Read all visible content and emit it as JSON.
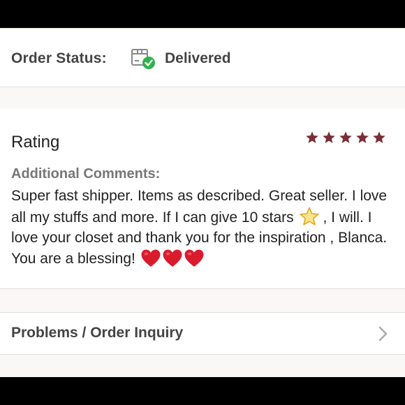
{
  "order_status": {
    "label": "Order Status:",
    "value": "Delivered",
    "icon": "package-delivered-icon"
  },
  "rating": {
    "title": "Rating",
    "stars": 5,
    "max_stars": 5,
    "star_color": "#7b2d35",
    "comments_label": "Additional Comments:",
    "comment_parts": [
      "Super fast shipper. Items as described. Great seller. I love all my stuffs and more. If I can give 10 stars",
      ", I will. I love your closet and thank you for the inspiration , Blanca. You are a blessing!"
    ],
    "emojis": [
      "star-emoji",
      "red-heart-emoji",
      "red-heart-emoji",
      "red-heart-emoji"
    ]
  },
  "inquiry": {
    "label": "Problems / Order Inquiry",
    "icon": "chevron-right-icon"
  },
  "colors": {
    "background": "#faf8f6",
    "card": "#ffffff",
    "divider": "#e2dcd6",
    "delivered_green": "#2db34a",
    "heart_red": "#d81c2e"
  }
}
